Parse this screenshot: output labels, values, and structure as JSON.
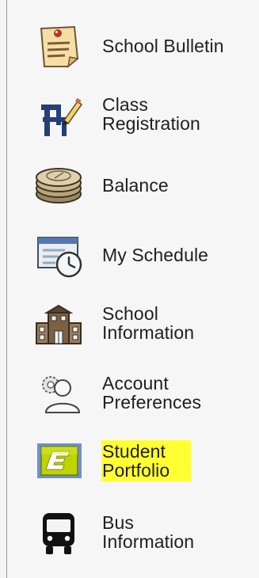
{
  "nav": {
    "items": [
      {
        "id": "school-bulletin",
        "icon": "bulletin-note-icon",
        "lines": [
          "School Bulletin"
        ]
      },
      {
        "id": "class-registration",
        "icon": "desk-pencil-icon",
        "lines": [
          "Class",
          "Registration"
        ]
      },
      {
        "id": "balance",
        "icon": "coin-stack-icon",
        "lines": [
          "Balance"
        ]
      },
      {
        "id": "my-schedule",
        "icon": "calendar-clock-icon",
        "lines": [
          "My Schedule"
        ]
      },
      {
        "id": "school-information",
        "icon": "school-building-icon",
        "lines": [
          "School",
          "Information"
        ]
      },
      {
        "id": "account-preferences",
        "icon": "user-gear-icon",
        "lines": [
          "Account",
          "Preferences"
        ]
      },
      {
        "id": "student-portfolio",
        "icon": "portfolio-e-icon",
        "lines": [
          "Student",
          "Portfolio"
        ],
        "highlighted": true,
        "highlight_color": "#ffff33"
      },
      {
        "id": "bus-information",
        "icon": "bus-icon",
        "lines": [
          "Bus",
          "Information"
        ]
      }
    ]
  }
}
